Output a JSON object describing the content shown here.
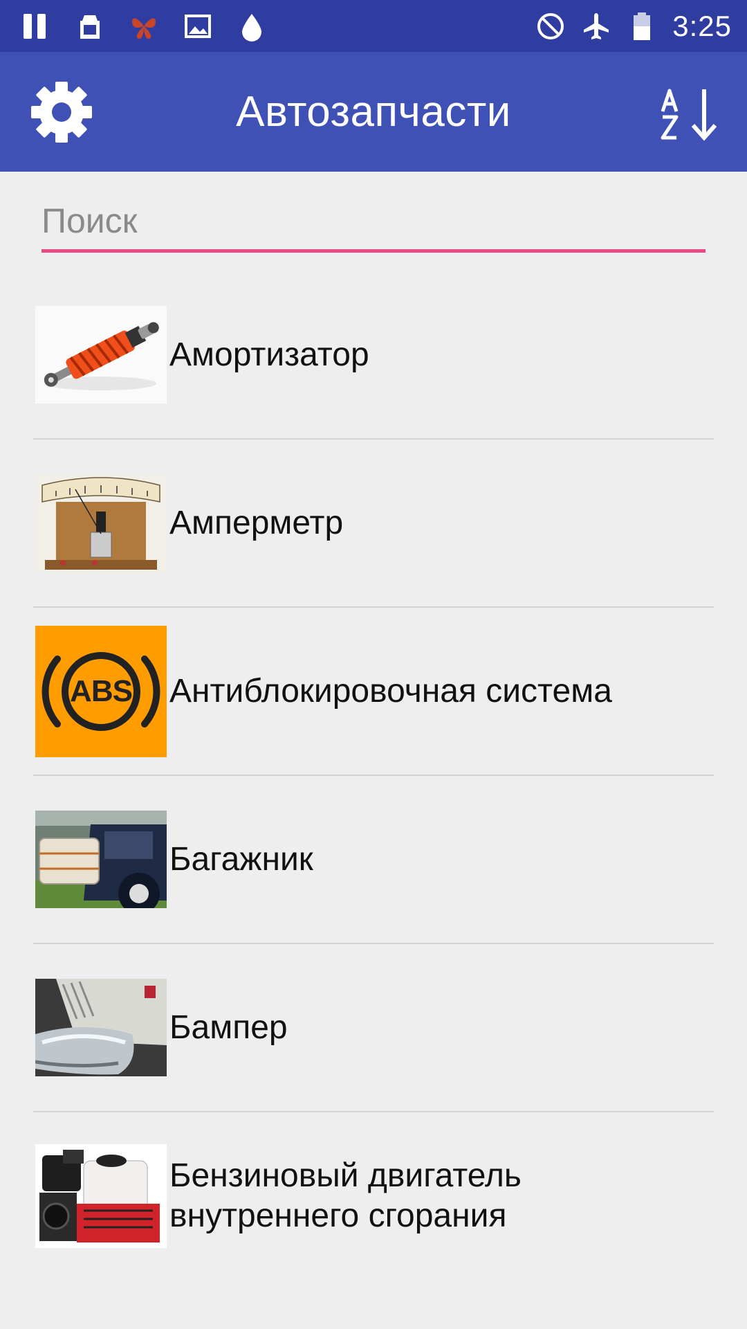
{
  "status_bar": {
    "time": "3:25",
    "left_icons": [
      "pause-icon",
      "clipboard-icon",
      "butterfly-icon",
      "image-icon",
      "drop-icon"
    ],
    "right_icons": [
      "do-not-disturb-icon",
      "airplane-icon",
      "battery-icon"
    ]
  },
  "app_bar": {
    "title": "Автозапчасти",
    "settings_icon": "gear-icon",
    "sort_icon": "sort-alpha-icon",
    "background": "#3f51b5",
    "status_background": "#2f3da0"
  },
  "search": {
    "placeholder": "Поиск",
    "value": "",
    "accent": "#e94a84"
  },
  "items": [
    {
      "label": "Амортизатор",
      "icon": "shock-absorber-image"
    },
    {
      "label": "Амперметр",
      "icon": "ammeter-image"
    },
    {
      "label": "Антиблокировочная система",
      "icon": "abs-image"
    },
    {
      "label": "Багажник",
      "icon": "trunk-image"
    },
    {
      "label": "Бампер",
      "icon": "bumper-image"
    },
    {
      "label": "Бензиновый двигатель внутреннего сгорания",
      "icon": "engine-image"
    }
  ]
}
